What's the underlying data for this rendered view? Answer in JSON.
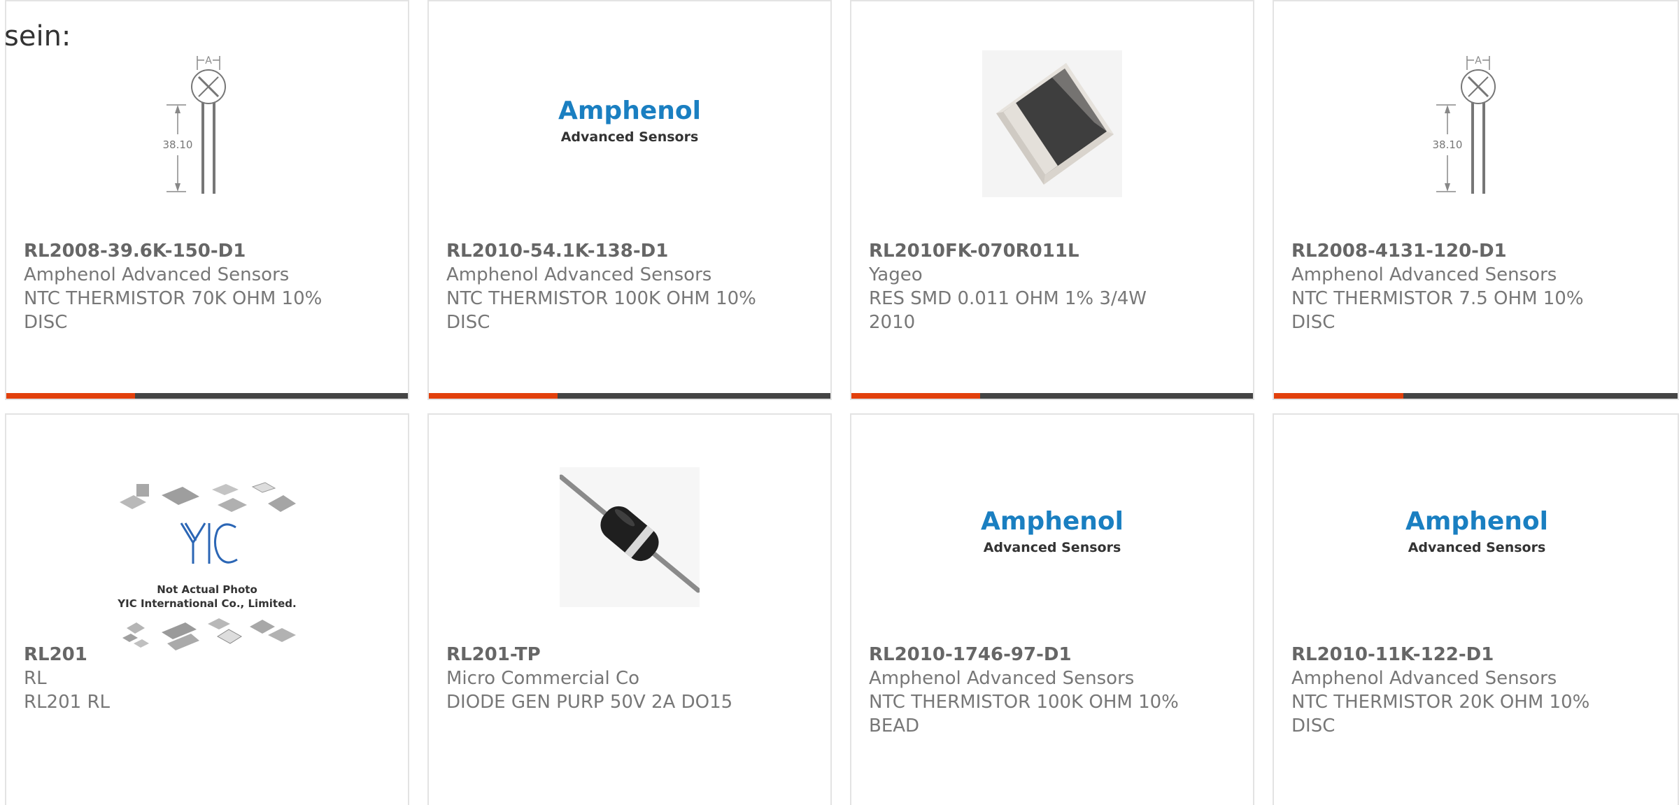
{
  "intro_text": "sein:",
  "accent_color": "#e2400c",
  "bar_color": "#444444",
  "logo": {
    "line1": "Amphenol",
    "line2": "Advanced Sensors"
  },
  "yic": {
    "line1": "Not Actual Photo",
    "line2": "YIC International Co., Limited."
  },
  "dimension_label": "38.10",
  "dimension_a": "A",
  "products": [
    {
      "part": "RL2008-39.6K-150-D1",
      "manufacturer": "Amphenol Advanced Sensors",
      "description": "NTC THERMISTOR 70K OHM 10% DISC",
      "image": "thermistor-drawing",
      "progress": 0.32
    },
    {
      "part": "RL2010-54.1K-138-D1",
      "manufacturer": "Amphenol Advanced Sensors",
      "description": "NTC THERMISTOR 100K OHM 10% DISC",
      "image": "amphenol-logo",
      "progress": 0.32
    },
    {
      "part": "RL2010FK-070R011L",
      "manufacturer": "Yageo",
      "description": "RES SMD 0.011 OHM 1% 3/4W 2010",
      "image": "smd-resistor",
      "progress": 0.32
    },
    {
      "part": "RL2008-4131-120-D1",
      "manufacturer": "Amphenol Advanced Sensors",
      "description": "NTC THERMISTOR 7.5 OHM 10% DISC",
      "image": "thermistor-drawing",
      "progress": 0.32
    },
    {
      "part": "RL201",
      "manufacturer": "RL",
      "description": "RL201 RL",
      "image": "yic-placeholder"
    },
    {
      "part": "RL201-TP",
      "manufacturer": "Micro Commercial Co",
      "description": "DIODE GEN PURP 50V 2A DO15",
      "image": "axial-diode"
    },
    {
      "part": "RL2010-1746-97-D1",
      "manufacturer": "Amphenol Advanced Sensors",
      "description": "NTC THERMISTOR 100K OHM 10% BEAD",
      "image": "amphenol-logo"
    },
    {
      "part": "RL2010-11K-122-D1",
      "manufacturer": "Amphenol Advanced Sensors",
      "description": "NTC THERMISTOR 20K OHM 10% DISC",
      "image": "amphenol-logo"
    }
  ]
}
